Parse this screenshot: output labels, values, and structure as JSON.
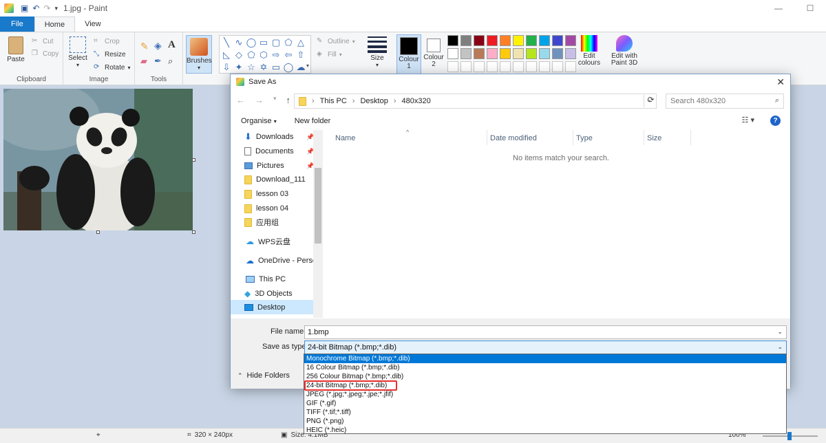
{
  "window": {
    "title": "1.jpg - Paint",
    "controls": [
      "—",
      "☐"
    ]
  },
  "tabs": [
    "File",
    "Home",
    "View"
  ],
  "ribbon": {
    "clipboard": {
      "paste": "Paste",
      "cut": "Cut",
      "copy": "Copy",
      "label": "Clipboard"
    },
    "image": {
      "select": "Select",
      "crop": "Crop",
      "resize": "Resize",
      "rotate": "Rotate",
      "label": "Image"
    },
    "tools": {
      "label": "Tools"
    },
    "brushes": "Brushes",
    "outline": "Outline",
    "fill": "Fill",
    "size": "Size",
    "colour1": "Colour\n1",
    "colour2": "Colour\n2",
    "edit_colours": "Edit\ncolours",
    "paint3d": "Edit with\nPaint 3D",
    "palette_row1": [
      "#000000",
      "#7f7f7f",
      "#880015",
      "#ed1c24",
      "#ff7f27",
      "#fff200",
      "#22b14c",
      "#00a2e8",
      "#3f48cc",
      "#a349a4"
    ],
    "palette_row2": [
      "#ffffff",
      "#c3c3c3",
      "#b97a57",
      "#ffaec9",
      "#ffc90e",
      "#efe4b0",
      "#b5e61d",
      "#99d9ea",
      "#7092be",
      "#c8bfe7"
    ]
  },
  "dialog": {
    "title": "Save As",
    "breadcrumb": [
      "This PC",
      "Desktop",
      "480x320"
    ],
    "search_placeholder": "Search 480x320",
    "organise": "Organise",
    "new_folder": "New folder",
    "nav_items": [
      "Downloads",
      "Documents",
      "Pictures",
      "Download_111",
      "lesson 03",
      "lesson 04",
      "应用组",
      "WPS云盘",
      "OneDrive - Person",
      "This PC",
      "3D Objects",
      "Desktop"
    ],
    "columns": [
      "Name",
      "Date modified",
      "Type",
      "Size"
    ],
    "empty_message": "No items match your search.",
    "file_name_label": "File name:",
    "file_name_value": "1.bmp",
    "save_type_label": "Save as type:",
    "save_type_value": "24-bit Bitmap (*.bmp;*.dib)",
    "hide_folders": "Hide Folders",
    "type_options": [
      "Monochrome Bitmap (*.bmp;*.dib)",
      "16 Colour Bitmap (*.bmp;*.dib)",
      "256 Colour Bitmap (*.bmp;*.dib)",
      "24-bit Bitmap (*.bmp;*.dib)",
      "JPEG (*.jpg;*.jpeg;*.jpe;*.jfif)",
      "GIF (*.gif)",
      "TIFF (*.tif;*.tiff)",
      "PNG (*.png)",
      "HEIC (*.heic)"
    ]
  },
  "status": {
    "dimensions": "320 × 240px",
    "size": "Size: 4.1MB",
    "zoom": "100%"
  }
}
